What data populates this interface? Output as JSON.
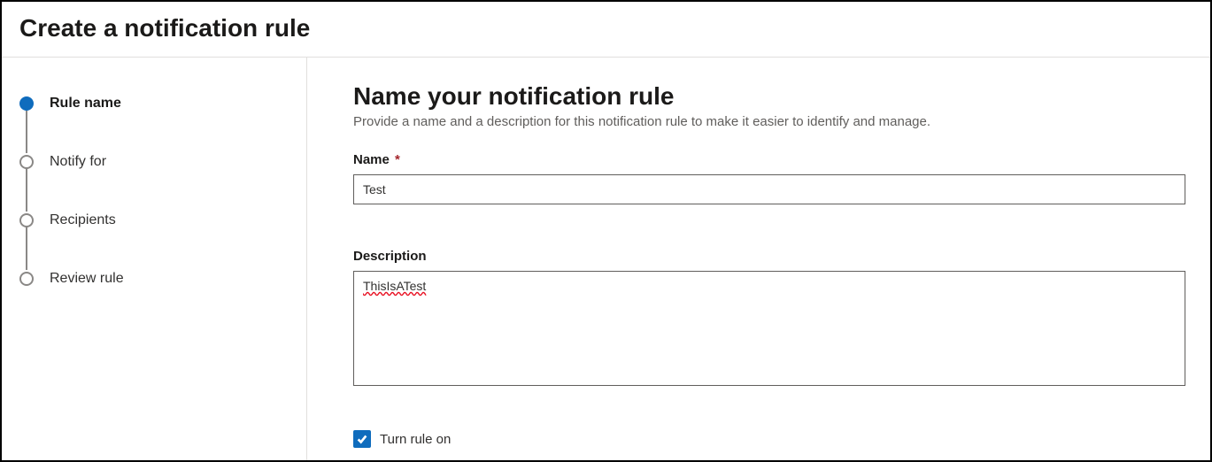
{
  "header": {
    "title": "Create a notification rule"
  },
  "sidebar": {
    "steps": [
      {
        "label": "Rule name",
        "active": true
      },
      {
        "label": "Notify for",
        "active": false
      },
      {
        "label": "Recipients",
        "active": false
      },
      {
        "label": "Review rule",
        "active": false
      }
    ]
  },
  "main": {
    "title": "Name your notification rule",
    "subtitle": "Provide a name and a description for this notification rule to make it easier to identify and manage.",
    "name_label": "Name",
    "name_required_marker": "*",
    "name_value": "Test",
    "description_label": "Description",
    "description_value": "ThisIsATest",
    "turn_on_label": "Turn rule on",
    "turn_on_checked": true
  }
}
